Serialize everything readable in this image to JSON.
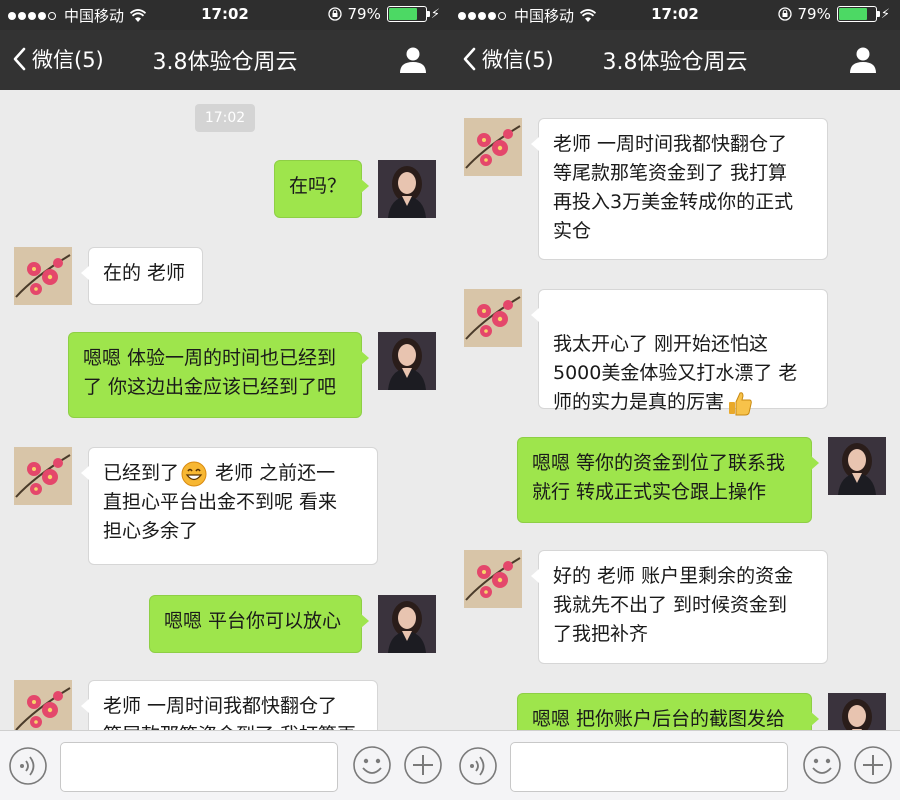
{
  "status": {
    "carrier": "中国移动",
    "time": "17:02",
    "battery": "79%",
    "battery_level": 0.79
  },
  "nav": {
    "back_label": "微信(5)",
    "title": "3.8体验仓周云"
  },
  "left": {
    "time_divider": "17:02",
    "messages": [
      {
        "side": "out",
        "text": "在吗？"
      },
      {
        "side": "in",
        "text": "在的 老师"
      },
      {
        "side": "out",
        "text": "嗯嗯 体验一周的时间也已经到\n了 你这边出金应该已经到了吧"
      },
      {
        "side": "in",
        "text_before_emoji": "已经到了",
        "text_after_emoji": " 老师 之前还一\n直担心平台出金不到呢 看来\n担心多余了"
      },
      {
        "side": "out",
        "text": "嗯嗯 平台你可以放心"
      },
      {
        "side": "in",
        "text": "老师 一周时间我都快翻仓了\n等尾款那笔资金到了 我打算再"
      }
    ]
  },
  "right": {
    "messages": [
      {
        "side": "in",
        "text": "老师 一周时间我都快翻仓了\n等尾款那笔资金到了 我打算\n再投入3万美金转成你的正式\n实仓"
      },
      {
        "side": "in",
        "text": "我太开心了 刚开始还怕这\n5000美金体验又打水漂了 老\n师的实力是真的厉害"
      },
      {
        "side": "out",
        "text": "嗯嗯 等你的资金到位了联系我\n就行 转成正式实仓跟上操作"
      },
      {
        "side": "in",
        "text": "好的 老师 账户里剩余的资金\n我就先不出了 到时候资金到\n了我把补齐"
      },
      {
        "side": "out",
        "text": "嗯嗯 把你账户后台的截图发给\n我"
      }
    ]
  },
  "icons": {
    "avatar_other": "plum-blossom-avatar-icon",
    "avatar_self": "woman-portrait-avatar-icon",
    "grin_emoji": "grinning-face-emoji-icon",
    "thumbs_emoji": "thumbs-up-emoji-icon"
  },
  "colors": {
    "outgoing_bubble": "#9ee54c",
    "incoming_bubble": "#ffffff",
    "navbar": "#333333",
    "background": "#ebebeb"
  }
}
